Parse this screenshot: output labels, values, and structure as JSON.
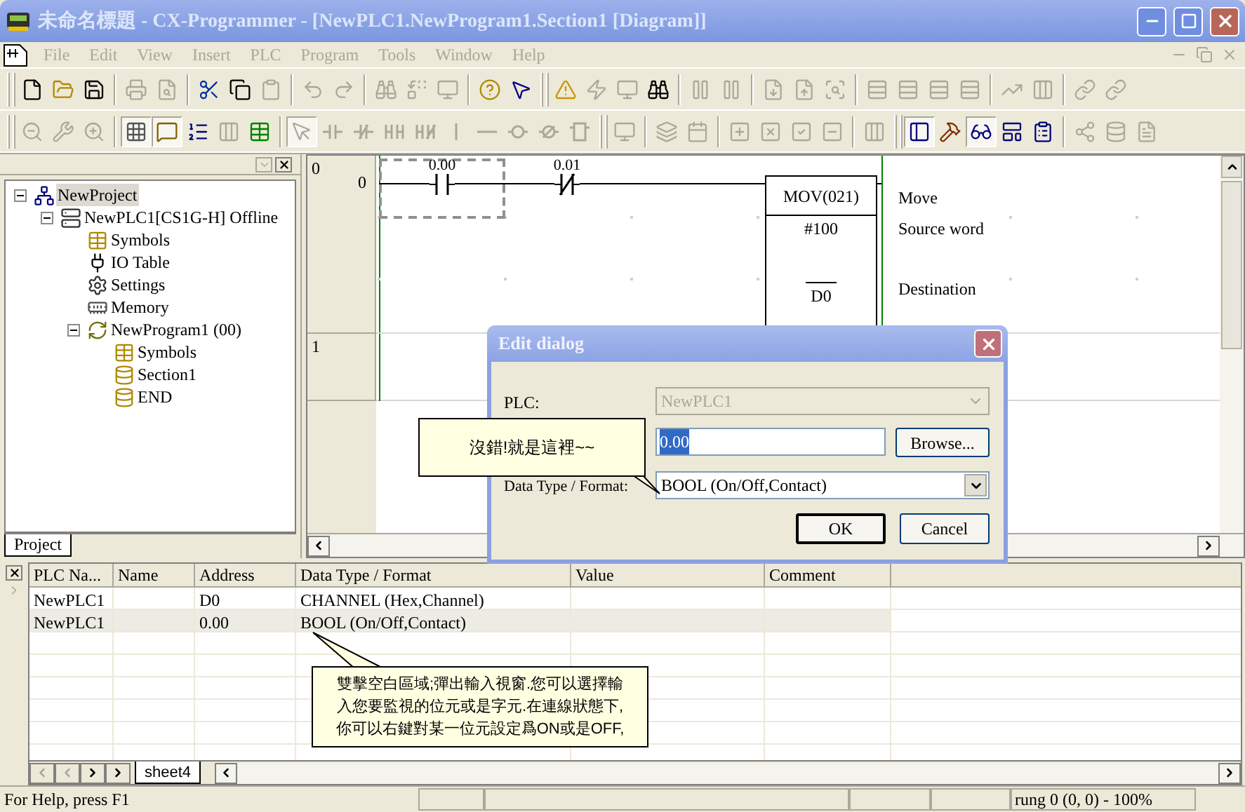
{
  "window": {
    "title": "未命名標題 - CX-Programmer - [NewPLC1.NewProgram1.Section1 [Diagram]]"
  },
  "menu": [
    {
      "label": "File",
      "disabled": true
    },
    {
      "label": "Edit",
      "disabled": true
    },
    {
      "label": "View",
      "disabled": true
    },
    {
      "label": "Insert",
      "disabled": true
    },
    {
      "label": "PLC",
      "disabled": true
    },
    {
      "label": "Program",
      "disabled": true
    },
    {
      "label": "Tools",
      "disabled": true
    },
    {
      "label": "Window",
      "disabled": true
    },
    {
      "label": "Help",
      "disabled": true
    }
  ],
  "toolbars": [
    [
      {
        "kind": "grip"
      },
      {
        "kind": "new",
        "disabled": false,
        "pressed": false
      },
      {
        "kind": "open",
        "disabled": false,
        "pressed": false
      },
      {
        "kind": "save",
        "disabled": false,
        "pressed": false
      },
      {
        "kind": "sep"
      },
      {
        "kind": "print",
        "disabled": true,
        "pressed": false
      },
      {
        "kind": "preview",
        "disabled": true,
        "pressed": false
      },
      {
        "kind": "sep"
      },
      {
        "kind": "cut",
        "disabled": false,
        "pressed": false
      },
      {
        "kind": "copy",
        "disabled": false,
        "pressed": false
      },
      {
        "kind": "paste",
        "disabled": true,
        "pressed": false
      },
      {
        "kind": "sep"
      },
      {
        "kind": "undo",
        "disabled": true,
        "pressed": false
      },
      {
        "kind": "redo",
        "disabled": true,
        "pressed": false
      },
      {
        "kind": "sep"
      },
      {
        "kind": "find",
        "disabled": true,
        "pressed": false
      },
      {
        "kind": "replace",
        "disabled": true,
        "pressed": false
      },
      {
        "kind": "monitor",
        "disabled": true,
        "pressed": false
      },
      {
        "kind": "sep"
      },
      {
        "kind": "help",
        "disabled": false,
        "pressed": false
      },
      {
        "kind": "whatsthis",
        "disabled": false,
        "pressed": false
      },
      {
        "kind": "grip"
      },
      {
        "kind": "warning",
        "disabled": false,
        "pressed": false
      },
      {
        "kind": "zap",
        "disabled": true,
        "pressed": false
      },
      {
        "kind": "monitor",
        "disabled": true,
        "pressed": false
      },
      {
        "kind": "findwarn",
        "disabled": false,
        "pressed": false
      },
      {
        "kind": "sep"
      },
      {
        "kind": "pause",
        "disabled": true,
        "pressed": false
      },
      {
        "kind": "pause",
        "disabled": true,
        "pressed": false
      },
      {
        "kind": "sep"
      },
      {
        "kind": "download",
        "disabled": true,
        "pressed": false
      },
      {
        "kind": "upload",
        "disabled": true,
        "pressed": false
      },
      {
        "kind": "compare",
        "disabled": true,
        "pressed": false
      },
      {
        "kind": "sep"
      },
      {
        "kind": "rows",
        "disabled": true,
        "pressed": false
      },
      {
        "kind": "rows",
        "disabled": true,
        "pressed": false
      },
      {
        "kind": "rows",
        "disabled": true,
        "pressed": false
      },
      {
        "kind": "rows",
        "disabled": true,
        "pressed": false
      },
      {
        "kind": "sep"
      },
      {
        "kind": "step",
        "disabled": true,
        "pressed": false
      },
      {
        "kind": "columns",
        "disabled": true,
        "pressed": false
      },
      {
        "kind": "sep"
      },
      {
        "kind": "link",
        "disabled": true,
        "pressed": false
      },
      {
        "kind": "link",
        "disabled": true,
        "pressed": false
      }
    ],
    [
      {
        "kind": "grip"
      },
      {
        "kind": "zoomsmall",
        "disabled": true,
        "pressed": false
      },
      {
        "kind": "tool",
        "disabled": true,
        "pressed": false
      },
      {
        "kind": "zoom",
        "disabled": true,
        "pressed": false
      },
      {
        "kind": "sep"
      },
      {
        "kind": "grid",
        "disabled": false,
        "pressed": true
      },
      {
        "kind": "comment",
        "disabled": false,
        "pressed": true
      },
      {
        "kind": "list",
        "disabled": false,
        "pressed": false
      },
      {
        "kind": "columns",
        "disabled": true,
        "pressed": false
      },
      {
        "kind": "table",
        "disabled": false,
        "pressed": false
      },
      {
        "kind": "sep"
      },
      {
        "kind": "pointer",
        "disabled": true,
        "pressed": true
      },
      {
        "kind": "no",
        "disabled": true,
        "pressed": false
      },
      {
        "kind": "nc",
        "disabled": true,
        "pressed": false
      },
      {
        "kind": "or",
        "disabled": true,
        "pressed": false
      },
      {
        "kind": "ornc",
        "disabled": true,
        "pressed": false
      },
      {
        "kind": "vline",
        "disabled": true,
        "pressed": false
      },
      {
        "kind": "hline",
        "disabled": true,
        "pressed": false
      },
      {
        "kind": "coil",
        "disabled": true,
        "pressed": false
      },
      {
        "kind": "coilnc",
        "disabled": true,
        "pressed": false
      },
      {
        "kind": "fbox",
        "disabled": true,
        "pressed": false
      },
      {
        "kind": "grip"
      },
      {
        "kind": "monitor",
        "disabled": true,
        "pressed": false
      },
      {
        "kind": "sep"
      },
      {
        "kind": "layers",
        "disabled": true,
        "pressed": false
      },
      {
        "kind": "calendar",
        "disabled": true,
        "pressed": false
      },
      {
        "kind": "sep"
      },
      {
        "kind": "sqplus",
        "disabled": true,
        "pressed": false
      },
      {
        "kind": "sqx",
        "disabled": true,
        "pressed": false
      },
      {
        "kind": "sqcheck",
        "disabled": true,
        "pressed": false
      },
      {
        "kind": "sqminus",
        "disabled": true,
        "pressed": false
      },
      {
        "kind": "sep"
      },
      {
        "kind": "columns",
        "disabled": true,
        "pressed": false
      },
      {
        "kind": "grip"
      },
      {
        "kind": "panel",
        "disabled": false,
        "pressed": true
      },
      {
        "kind": "hammer",
        "disabled": false,
        "pressed": false
      },
      {
        "kind": "glasses",
        "disabled": false,
        "pressed": true
      },
      {
        "kind": "layout",
        "disabled": false,
        "pressed": false
      },
      {
        "kind": "clist",
        "disabled": false,
        "pressed": false
      },
      {
        "kind": "sep"
      },
      {
        "kind": "share",
        "disabled": true,
        "pressed": false
      },
      {
        "kind": "database",
        "disabled": true,
        "pressed": false
      },
      {
        "kind": "file2",
        "disabled": true,
        "pressed": false
      }
    ]
  ],
  "project_tree": {
    "tabs": [
      {
        "label": "Project",
        "selected": true
      }
    ],
    "items": [
      {
        "label": "NewProject",
        "kind": "project",
        "selected": true,
        "expanded": true,
        "children": [
          {
            "label": "NewPLC1[CS1G-H] Offline",
            "kind": "plc",
            "selected": false,
            "expanded": true,
            "children": [
              {
                "label": "Symbols",
                "kind": "symbols",
                "selected": false
              },
              {
                "label": "IO Table",
                "kind": "io_table",
                "selected": false
              },
              {
                "label": "Settings",
                "kind": "settings",
                "selected": false
              },
              {
                "label": "Memory",
                "kind": "memory",
                "selected": false
              },
              {
                "label": "NewProgram1 (00)",
                "kind": "program",
                "selected": false,
                "expanded": true,
                "children": [
                  {
                    "label": "Symbols",
                    "kind": "symbols",
                    "selected": false
                  },
                  {
                    "label": "Section1",
                    "kind": "section",
                    "selected": false
                  },
                  {
                    "label": "END",
                    "kind": "section",
                    "selected": false
                  }
                ]
              }
            ]
          }
        ]
      }
    ]
  },
  "diagram": {
    "rungs": [
      {
        "number": "0",
        "step": "0",
        "contacts": [
          {
            "address": "0.00",
            "kind": "no",
            "selected": true
          },
          {
            "address": "0.01",
            "kind": "nc",
            "selected": false
          }
        ],
        "instruction": {
          "mnemonic": "MOV(021)",
          "comment": "Move",
          "operands": [
            {
              "value": "#100",
              "comment": "Source word",
              "overline": false
            },
            {
              "value": "D0",
              "comment": "Destination",
              "overline": true
            }
          ]
        }
      },
      {
        "number": "1"
      }
    ]
  },
  "dialog": {
    "title": "Edit dialog",
    "plc": {
      "label": "PLC:",
      "value": "NewPLC1",
      "disabled": true
    },
    "address": {
      "value": "0.00",
      "selected": true,
      "button": "Browse..."
    },
    "data_type": {
      "label": "Data Type / Format:",
      "value": "BOOL (On/Off,Contact)",
      "disabled": false
    },
    "buttons": [
      {
        "label": "OK",
        "default": true
      },
      {
        "label": "Cancel",
        "default": false
      }
    ]
  },
  "callouts": [
    {
      "lines": [
        "沒錯!就是這裡~~"
      ]
    },
    {
      "lines": [
        "雙擊空白區域;彈出輸入視窗.您可以選擇輸",
        "入您要監視的位元或是字元.在連線狀態下,",
        "你可以右鍵對某一位元設定爲ON或是OFF,"
      ]
    }
  ],
  "watch": {
    "columns": [
      "PLC Na...",
      "Name",
      "Address",
      "Data Type / Format",
      "Value",
      "Comment"
    ],
    "rows": [
      {
        "plc": "NewPLC1",
        "address": "D0",
        "data_type": "CHANNEL (Hex,Channel)",
        "selected": false
      },
      {
        "plc": "NewPLC1",
        "address": "0.00",
        "data_type": "BOOL (On/Off,Contact)",
        "selected": true
      }
    ],
    "sheets": [
      {
        "label": "sheet4",
        "selected": true
      }
    ]
  },
  "status_bar": {
    "help": "For Help, press F1",
    "position": "rung 0 (0, 0) - 100%"
  }
}
